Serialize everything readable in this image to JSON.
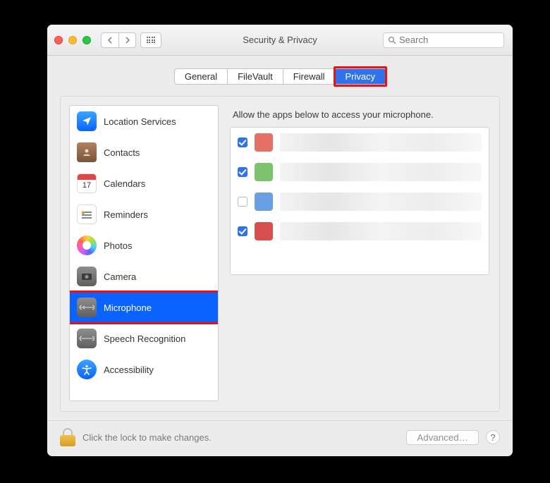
{
  "window": {
    "title": "Security & Privacy"
  },
  "search": {
    "placeholder": "Search"
  },
  "tabs": [
    {
      "label": "General",
      "active": false
    },
    {
      "label": "FileVault",
      "active": false
    },
    {
      "label": "Firewall",
      "active": false
    },
    {
      "label": "Privacy",
      "active": true
    }
  ],
  "sidebar": {
    "items": [
      {
        "label": "Location Services",
        "icon": "location-icon"
      },
      {
        "label": "Contacts",
        "icon": "contacts-icon"
      },
      {
        "label": "Calendars",
        "icon": "calendar-icon",
        "day": "17"
      },
      {
        "label": "Reminders",
        "icon": "reminders-icon"
      },
      {
        "label": "Photos",
        "icon": "photos-icon"
      },
      {
        "label": "Camera",
        "icon": "camera-icon"
      },
      {
        "label": "Microphone",
        "icon": "microphone-icon",
        "selected": true
      },
      {
        "label": "Speech Recognition",
        "icon": "speech-icon"
      },
      {
        "label": "Accessibility",
        "icon": "accessibility-icon"
      }
    ]
  },
  "main": {
    "description": "Allow the apps below to access your microphone.",
    "apps": [
      {
        "checked": true,
        "icon_color": "#e77066"
      },
      {
        "checked": true,
        "icon_color": "#7cc36d"
      },
      {
        "checked": false,
        "icon_color": "#6aa0e3"
      },
      {
        "checked": true,
        "icon_color": "#d84f4f"
      }
    ]
  },
  "footer": {
    "lock_text": "Click the lock to make changes.",
    "advanced": "Advanced…",
    "help": "?"
  },
  "highlights": {
    "tab_index": 3,
    "sidebar_index": 6
  }
}
